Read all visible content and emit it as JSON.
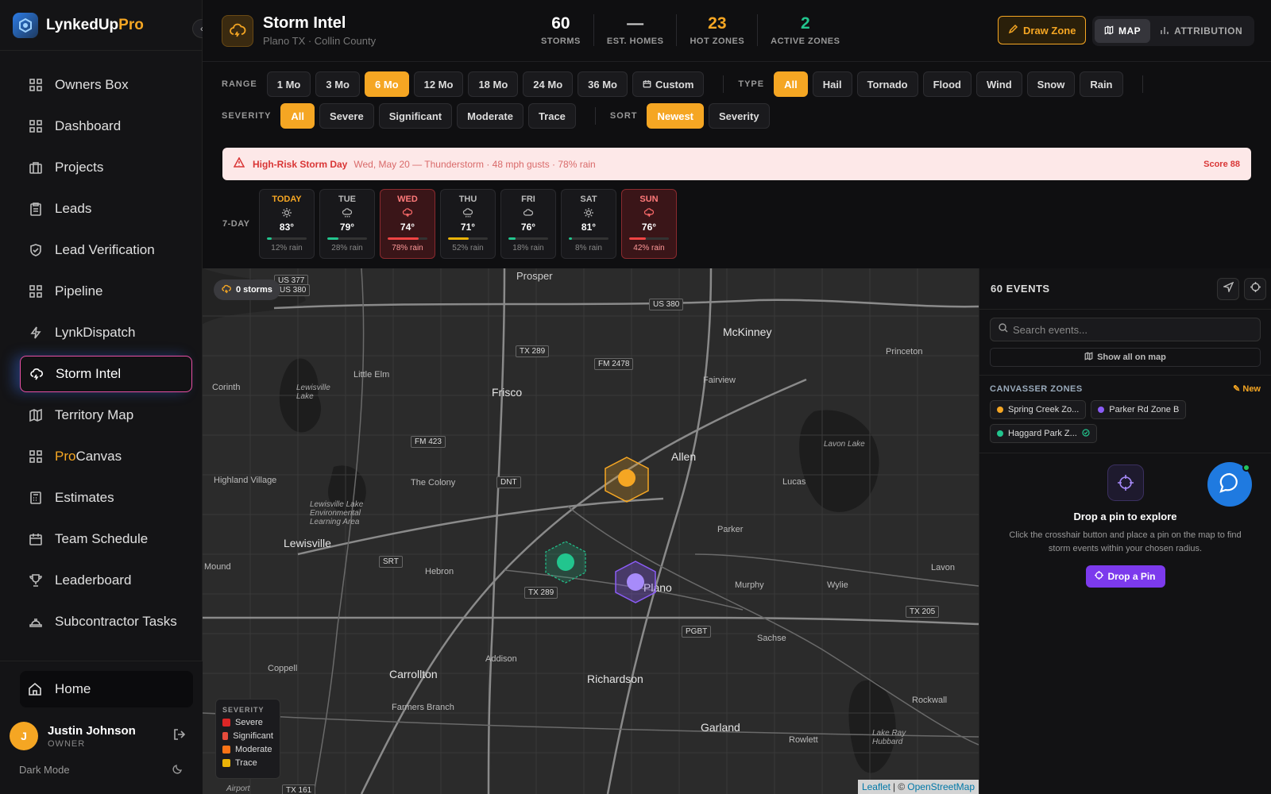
{
  "brand": {
    "name": "LynkedUp",
    "suffix": "Pro"
  },
  "nav": [
    {
      "label": "Owners Box",
      "icon": "grid-icon"
    },
    {
      "label": "Dashboard",
      "icon": "grid-icon"
    },
    {
      "label": "Projects",
      "icon": "briefcase-icon"
    },
    {
      "label": "Leads",
      "icon": "clipboard-icon"
    },
    {
      "label": "Lead Verification",
      "icon": "shield-check-icon"
    },
    {
      "label": "Pipeline",
      "icon": "grid-icon"
    },
    {
      "label": "LynkDispatch",
      "icon": "bolt-icon"
    },
    {
      "label": "Storm Intel",
      "icon": "storm-cloud-icon"
    },
    {
      "label": "Territory Map",
      "icon": "map-icon"
    },
    {
      "label_pro": "Pro",
      "label": "Canvas",
      "icon": "grid-icon"
    },
    {
      "label": "Estimates",
      "icon": "calculator-icon"
    },
    {
      "label": "Team Schedule",
      "icon": "calendar-icon"
    },
    {
      "label": "Leaderboard",
      "icon": "trophy-icon"
    },
    {
      "label": "Subcontractor Tasks",
      "icon": "hardhat-icon"
    }
  ],
  "footer": {
    "home": "Home",
    "user_name": "Justin Johnson",
    "user_role": "OWNER",
    "avatar_letter": "J",
    "dark_mode": "Dark Mode"
  },
  "header": {
    "title": "Storm Intel",
    "subtitle": "Plano TX · Collin County",
    "stats": [
      {
        "value": "60",
        "label": "STORMS",
        "color": "#ffffff"
      },
      {
        "value": "—",
        "label": "EST. HOMES",
        "color": "#cccccc"
      },
      {
        "value": "23",
        "label": "HOT ZONES",
        "color": "#f5a623"
      },
      {
        "value": "2",
        "label": "ACTIVE ZONES",
        "color": "#22c58e"
      }
    ],
    "draw_zone": "Draw Zone",
    "view_map": "MAP",
    "view_attribution": "ATTRIBUTION"
  },
  "filters": {
    "range_label": "RANGE",
    "range": [
      "1 Mo",
      "3 Mo",
      "6 Mo",
      "12 Mo",
      "18 Mo",
      "24 Mo",
      "36 Mo"
    ],
    "range_selected": "6 Mo",
    "custom": "Custom",
    "type_label": "TYPE",
    "types": [
      "All",
      "Hail",
      "Tornado",
      "Flood",
      "Wind",
      "Snow",
      "Rain"
    ],
    "type_selected": "All",
    "severity_label": "SEVERITY",
    "severities": [
      "All",
      "Severe",
      "Significant",
      "Moderate",
      "Trace"
    ],
    "severity_selected": "All",
    "sort_label": "SORT",
    "sorts": [
      "Newest",
      "Severity"
    ],
    "sort_selected": "Newest"
  },
  "alert": {
    "title": "High-Risk Storm Day",
    "detail": "Wed, May 20 — Thunderstorm · 48 mph gusts · 78% rain",
    "score": "Score 88"
  },
  "forecast": {
    "label": "7-DAY",
    "days": [
      {
        "name": "TODAY",
        "icon": "sun-icon",
        "temp": "83°",
        "rain": "12% rain",
        "rain_pct": 12,
        "state": "today"
      },
      {
        "name": "TUE",
        "icon": "cloud-rain-icon",
        "temp": "79°",
        "rain": "28% rain",
        "rain_pct": 28,
        "state": "normal"
      },
      {
        "name": "WED",
        "icon": "storm-icon",
        "temp": "74°",
        "rain": "78% rain",
        "rain_pct": 78,
        "state": "hot"
      },
      {
        "name": "THU",
        "icon": "cloud-rain-icon",
        "temp": "71°",
        "rain": "52% rain",
        "rain_pct": 52,
        "state": "normal"
      },
      {
        "name": "FRI",
        "icon": "cloud-icon",
        "temp": "76°",
        "rain": "18% rain",
        "rain_pct": 18,
        "state": "normal"
      },
      {
        "name": "SAT",
        "icon": "sun-icon",
        "temp": "81°",
        "rain": "8% rain",
        "rain_pct": 8,
        "state": "normal"
      },
      {
        "name": "SUN",
        "icon": "storm-icon",
        "temp": "76°",
        "rain": "42% rain",
        "rain_pct": 42,
        "state": "hot"
      }
    ]
  },
  "map": {
    "storm_pill": "0 storms",
    "labels": [
      "Prosper",
      "McKinney",
      "Princeton",
      "Frisco",
      "Little Elm",
      "Fairview",
      "Corinth",
      "Lewisville Lake",
      "Allen",
      "Lavon Lake",
      "Lucas",
      "The Colony",
      "Highland Village",
      "Lewisville",
      "Lewisville Lake Environmental Learning Area",
      "Parker",
      "Hebron",
      "Plano",
      "Murphy",
      "Wylie",
      "Lavon",
      "Mound",
      "Addison",
      "Sachse",
      "Coppell",
      "Carrollton",
      "Richardson",
      "Farmers Branch",
      "Garland",
      "Rowlett",
      "Rockwall",
      "Lake Ray Hubbard",
      "Airport"
    ],
    "shields": [
      "US 377",
      "US 380",
      "US 380",
      "TX 289",
      "FM 2478",
      "FM 423",
      "DNT",
      "SRT",
      "TX 289",
      "TX 205",
      "PGBT",
      "TX 161"
    ],
    "legend_title": "SEVERITY",
    "legend": [
      {
        "label": "Severe",
        "color": "#dc2626"
      },
      {
        "label": "Significant",
        "color": "#e74c3c"
      },
      {
        "label": "Moderate",
        "color": "#f97316"
      },
      {
        "label": "Trace",
        "color": "#eab308"
      }
    ],
    "attribution_leaflet": "Leaflet",
    "attribution_osm": "OpenStreetMap",
    "markers": [
      {
        "color": "#f5a623",
        "name": "Spring Creek Zone"
      },
      {
        "color": "#22c58e",
        "name": "Haggard Park Zone"
      },
      {
        "color": "#8b5cf6",
        "name": "Parker Rd Zone B"
      }
    ]
  },
  "panel": {
    "title": "60 EVENTS",
    "search_placeholder": "Search events...",
    "show_all": "Show all on map",
    "zones_title": "CANVASSER ZONES",
    "zones_new": "New",
    "zones": [
      {
        "label": "Spring Creek Zo...",
        "color": "#f5a623"
      },
      {
        "label": "Parker Rd Zone B",
        "color": "#8b5cf6"
      },
      {
        "label": "Haggard Park Z...",
        "color": "#22c58e"
      }
    ],
    "drop_title": "Drop a pin to explore",
    "drop_desc": "Click the crosshair button and place a pin on the map to find storm events within your chosen radius.",
    "drop_btn": "Drop a Pin"
  }
}
